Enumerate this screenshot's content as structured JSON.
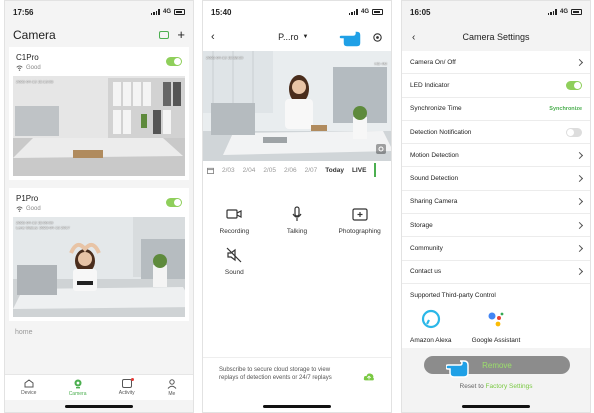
{
  "screen1": {
    "time": "17:56",
    "network": "4G",
    "title": "Camera",
    "cameras": [
      {
        "name": "C1Pro",
        "status": "Good",
        "timestamp": "2023-04-13  15:13:08"
      },
      {
        "name": "P1Pro",
        "status": "Good",
        "timestamp": "2023-04-13  15:09:09",
        "subtitle": "Lens Status: 2023-04-13 2017"
      }
    ],
    "home_label": "home",
    "tabs": [
      "Device",
      "Camera",
      "Activity",
      "Me"
    ]
  },
  "screen2": {
    "time": "15:40",
    "network": "4G",
    "title": "P...ro",
    "video_timestamp": "2023-04-13 15:38:30",
    "video_hd": "HD 4M",
    "timeline": [
      "2/03",
      "2/04",
      "2/05",
      "2/06",
      "2/07",
      "Today",
      "LIVE"
    ],
    "actions": [
      "Recording",
      "Talking",
      "Photographing",
      "Sound"
    ],
    "promo_text": "Subscribe to secure cloud storage to view replays of detection events or 24/7 replays"
  },
  "screen3": {
    "time": "16:05",
    "network": "4G",
    "title": "Camera Settings",
    "rows": [
      {
        "label": "Camera On/ Off",
        "type": "chevron"
      },
      {
        "label": "LED Indicator",
        "type": "toggle-on"
      },
      {
        "label": "Synchronize Time",
        "type": "text",
        "value": "Synchronize"
      },
      {
        "label": "Detection Notification",
        "type": "toggle-off"
      },
      {
        "label": "Motion Detection",
        "type": "chevron"
      },
      {
        "label": "Sound Detection",
        "type": "chevron"
      },
      {
        "label": "Sharing Camera",
        "type": "chevron"
      },
      {
        "label": "Storage",
        "type": "chevron"
      },
      {
        "label": "Community",
        "type": "chevron"
      },
      {
        "label": "Contact us",
        "type": "chevron"
      }
    ],
    "third_party_title": "Supported Third-party Control",
    "assistants": [
      "Amazon Alexa",
      "Google Assistant"
    ],
    "remove_label": "Remove",
    "reset_prefix": "Reset to",
    "reset_link": "Factory Settings"
  },
  "colors": {
    "accent": "#4caf50",
    "toggle_on": "#8fcf5b",
    "hand": "#1fa0e6",
    "remove_bg": "#8c8c8c"
  }
}
